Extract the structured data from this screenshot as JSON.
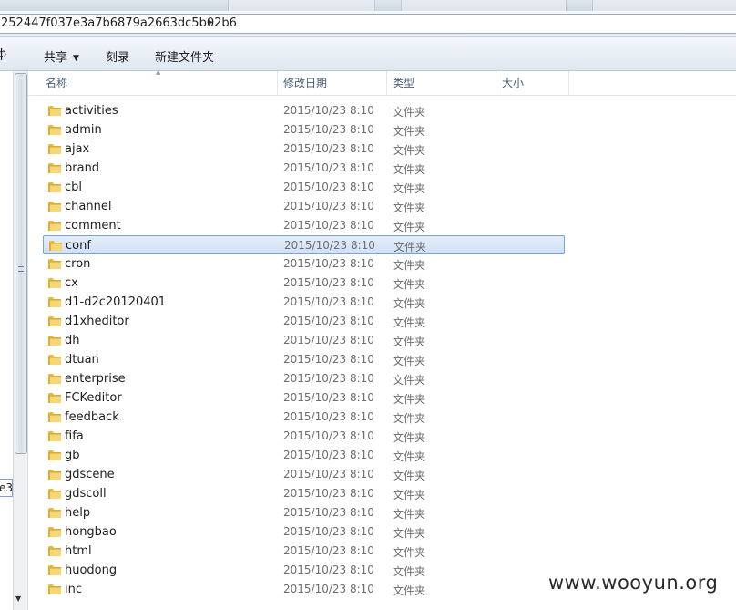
{
  "address": {
    "path_text": "252447f037e3a7b6879a2663dc5b02b6",
    "chevron": "▸"
  },
  "toolbar": {
    "left_cut": "ф",
    "share_label": "共享",
    "burn_label": "刻录",
    "new_folder_label": "新建文件夹"
  },
  "left_pane": {
    "selected_fragment": "e3"
  },
  "columns": {
    "name": "名称",
    "date": "修改日期",
    "type": "类型",
    "size": "大小"
  },
  "rows": [
    {
      "name": "activities",
      "date": "2015/10/23 8:10",
      "type": "文件夹"
    },
    {
      "name": "admin",
      "date": "2015/10/23 8:10",
      "type": "文件夹"
    },
    {
      "name": "ajax",
      "date": "2015/10/23 8:10",
      "type": "文件夹"
    },
    {
      "name": "brand",
      "date": "2015/10/23 8:10",
      "type": "文件夹"
    },
    {
      "name": "cbl",
      "date": "2015/10/23 8:10",
      "type": "文件夹"
    },
    {
      "name": "channel",
      "date": "2015/10/23 8:10",
      "type": "文件夹"
    },
    {
      "name": "comment",
      "date": "2015/10/23 8:10",
      "type": "文件夹"
    },
    {
      "name": "conf",
      "date": "2015/10/23 8:10",
      "type": "文件夹",
      "selected": true
    },
    {
      "name": "cron",
      "date": "2015/10/23 8:10",
      "type": "文件夹"
    },
    {
      "name": "cx",
      "date": "2015/10/23 8:10",
      "type": "文件夹"
    },
    {
      "name": "d1-d2c20120401",
      "date": "2015/10/23 8:10",
      "type": "文件夹"
    },
    {
      "name": "d1xheditor",
      "date": "2015/10/23 8:10",
      "type": "文件夹"
    },
    {
      "name": "dh",
      "date": "2015/10/23 8:10",
      "type": "文件夹"
    },
    {
      "name": "dtuan",
      "date": "2015/10/23 8:10",
      "type": "文件夹"
    },
    {
      "name": "enterprise",
      "date": "2015/10/23 8:10",
      "type": "文件夹"
    },
    {
      "name": "FCKeditor",
      "date": "2015/10/23 8:10",
      "type": "文件夹"
    },
    {
      "name": "feedback",
      "date": "2015/10/23 8:10",
      "type": "文件夹"
    },
    {
      "name": "fifa",
      "date": "2015/10/23 8:10",
      "type": "文件夹"
    },
    {
      "name": "gb",
      "date": "2015/10/23 8:10",
      "type": "文件夹"
    },
    {
      "name": "gdscene",
      "date": "2015/10/23 8:10",
      "type": "文件夹"
    },
    {
      "name": "gdscoll",
      "date": "2015/10/23 8:10",
      "type": "文件夹"
    },
    {
      "name": "help",
      "date": "2015/10/23 8:10",
      "type": "文件夹"
    },
    {
      "name": "hongbao",
      "date": "2015/10/23 8:10",
      "type": "文件夹"
    },
    {
      "name": "html",
      "date": "2015/10/23 8:10",
      "type": "文件夹"
    },
    {
      "name": "huodong",
      "date": "2015/10/23 8:10",
      "type": "文件夹"
    },
    {
      "name": "inc",
      "date": "2015/10/23 8:10",
      "type": "文件夹"
    }
  ],
  "icons": {
    "folder": "folder-icon",
    "sort": "sort-ascending-icon",
    "scroll_down": "scroll-down-arrow-icon"
  },
  "colors": {
    "selection_border": "#7da2ce",
    "selection_fill": "#cfe0f6",
    "folder": "#f2c94c",
    "header_text": "#4c607a",
    "secondary_text": "#6d6d6d"
  },
  "watermark": "www.wooyun.org"
}
